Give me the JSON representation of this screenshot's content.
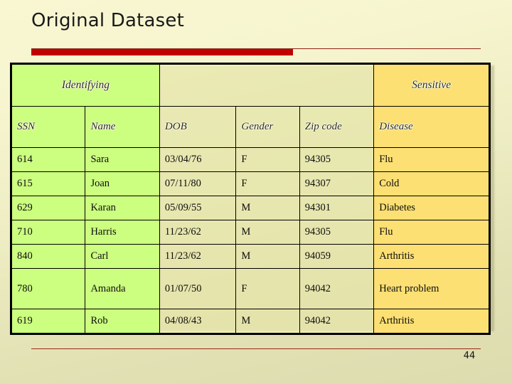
{
  "slide": {
    "title": "Original Dataset",
    "page_number": "44",
    "accent_color": "#c00000",
    "rule_color": "#8c2016"
  },
  "table": {
    "group_headers": [
      {
        "label": "Identifying",
        "category": "identifying",
        "color": "#ccfe80",
        "span": 2
      },
      {
        "label": "",
        "category": "quasi-identifier",
        "color": "#fdfdcc",
        "span": 3
      },
      {
        "label": "Sensitive",
        "category": "sensitive",
        "color": "#fde073",
        "span": 1
      }
    ],
    "columns": [
      {
        "label": "SSN",
        "category": "identifying"
      },
      {
        "label": "Name",
        "category": "identifying"
      },
      {
        "label": "DOB",
        "category": "quasi-identifier"
      },
      {
        "label": "Gender",
        "category": "quasi-identifier"
      },
      {
        "label": "Zip code",
        "category": "quasi-identifier"
      },
      {
        "label": "Disease",
        "category": "sensitive"
      }
    ],
    "rows": [
      {
        "ssn": "614",
        "name": "Sara",
        "dob": "03/04/76",
        "gender": "F",
        "zip": "94305",
        "disease": "Flu",
        "tall": false
      },
      {
        "ssn": "615",
        "name": "Joan",
        "dob": "07/11/80",
        "gender": "F",
        "zip": "94307",
        "disease": "Cold",
        "tall": false
      },
      {
        "ssn": "629",
        "name": "Karan",
        "dob": "05/09/55",
        "gender": "M",
        "zip": "94301",
        "disease": "Diabetes",
        "tall": false
      },
      {
        "ssn": "710",
        "name": "Harris",
        "dob": "11/23/62",
        "gender": "M",
        "zip": "94305",
        "disease": "Flu",
        "tall": false
      },
      {
        "ssn": "840",
        "name": "Carl",
        "dob": "11/23/62",
        "gender": "M",
        "zip": "94059",
        "disease": "Arthritis",
        "tall": false
      },
      {
        "ssn": "780",
        "name": "Amanda",
        "dob": "01/07/50",
        "gender": "F",
        "zip": "94042",
        "disease": "Heart problem",
        "tall": true
      },
      {
        "ssn": "619",
        "name": "Rob",
        "dob": "04/08/43",
        "gender": "M",
        "zip": "94042",
        "disease": "Arthritis",
        "tall": false
      }
    ]
  }
}
